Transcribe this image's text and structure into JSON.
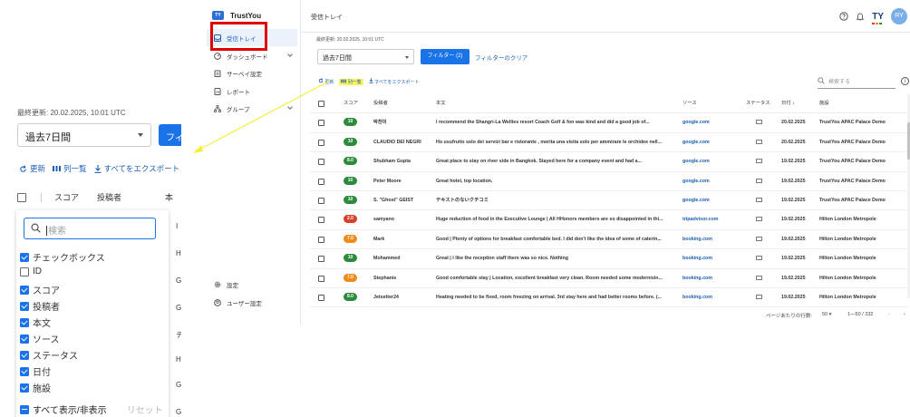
{
  "zoom": {
    "last_updated": "最終更新: 20.02.2025, 10:01 UTC",
    "period": "過去7日間",
    "filter_label": "フィ",
    "actions": {
      "refresh": "更新",
      "list": "列一覧",
      "export": "すべてをエクスポート"
    },
    "header": {
      "score": "スコア",
      "author": "投稿者",
      "cut": "本"
    },
    "search_placeholder": "検索",
    "columns": [
      {
        "label": "チェックボックス",
        "checked": true
      },
      {
        "label": "ID",
        "checked": false
      },
      {
        "label": "スコア",
        "checked": true
      },
      {
        "label": "投稿者",
        "checked": true
      },
      {
        "label": "本文",
        "checked": true
      },
      {
        "label": "ソース",
        "checked": true
      },
      {
        "label": "ステータス",
        "checked": true
      },
      {
        "label": "日付",
        "checked": true
      },
      {
        "label": "施設",
        "checked": true
      }
    ],
    "toggle_all": "すべて表示/非表示",
    "reset": "リセット",
    "side_letters": [
      "I",
      "H",
      "G",
      "G",
      "テ",
      "H",
      "G",
      "G"
    ]
  },
  "sidebar": {
    "brand": "TrustYou",
    "brand_logo": "TY",
    "items": [
      {
        "label": "受信トレイ",
        "icon": "inbox-icon"
      },
      {
        "label": "ダッシュボード",
        "icon": "dashboard-icon"
      },
      {
        "label": "サーベイ設定",
        "icon": "clipboard-icon"
      },
      {
        "label": "レポート",
        "icon": "report-icon"
      },
      {
        "label": "グループ",
        "icon": "hierarchy-icon"
      }
    ],
    "bottom": [
      {
        "label": "設定",
        "icon": "gear-icon"
      },
      {
        "label": "ユーザー設定",
        "icon": "user-icon"
      }
    ]
  },
  "header": {
    "title": "受信トレイ",
    "logo_text": "TY",
    "avatar": "RY"
  },
  "main": {
    "last_updated": "最終更新: 20.02.2025, 10:01 UTC",
    "period": "過去7日間",
    "filter_button": "フィルター (2)",
    "clear_filter": "フィルターのクリア",
    "actions": {
      "refresh": "更新",
      "list": "列一覧",
      "export": "すべてをエクスポート"
    },
    "search_placeholder": "検索する",
    "columns": {
      "score": "スコア",
      "author": "投稿者",
      "body": "本文",
      "source": "ソース",
      "status": "ステータス",
      "date": "日付",
      "property": "施設"
    },
    "rows": [
      {
        "score": "10",
        "color": "#2e8b3e",
        "author": "박찬미",
        "body": "I recommend the Shangri-La Wellies resort Coach Golf & fon was kind and did a good job of...",
        "source": "google.com",
        "date": "20.02.2025",
        "property": "TrustYou APAC Palace Demo"
      },
      {
        "score": "10",
        "color": "#2e8b3e",
        "author": "CLAUDIO DEI NEGRI",
        "body": "Ho usufruito solo dei servizi bar e ristorante , merita una visita solo per ammirare le orchidee nell...",
        "source": "google.com",
        "date": "20.02.2025",
        "property": "TrustYou APAC Palace Demo"
      },
      {
        "score": "8.0",
        "color": "#2e8b3e",
        "author": "Shubham Gupta",
        "body": "Great place to stay on river side in Bangkok. Stayed here for a company event and had a...",
        "source": "google.com",
        "date": "19.02.2025",
        "property": "TrustYou APAC Palace Demo"
      },
      {
        "score": "10",
        "color": "#2e8b3e",
        "author": "Peter Moore",
        "body": "Great hotel, top location.",
        "source": "google.com",
        "date": "19.02.2025",
        "property": "TrustYou APAC Palace Demo"
      },
      {
        "score": "10",
        "color": "#2e8b3e",
        "author": "S. \"Ghost\" GEIST",
        "body": "テキストのないクチコミ",
        "source": "google.com",
        "date": "19.02.2025",
        "property": "TrustYou APAC Palace Demo"
      },
      {
        "score": "2.0",
        "color": "#d9402b",
        "author": "samyano",
        "body": "Huge reduction of food in the Executive Lounge | All HHonors members are so disappointed in thi...",
        "source": "tripadvisor.com",
        "date": "19.02.2025",
        "property": "Hilton London Metropole"
      },
      {
        "score": "7.0",
        "color": "#f08a1c",
        "author": "Mark",
        "body": "Good | Plenty of options for breakfast comfortable bed. I did don't like the idea of some of caterin...",
        "source": "booking.com",
        "date": "19.02.2025",
        "property": "Hilton London Metropole"
      },
      {
        "score": "10",
        "color": "#2e8b3e",
        "author": "Mohammed",
        "body": "Great | I like the reception staff there was so nice. Nothing",
        "source": "booking.com",
        "date": "19.02.2025",
        "property": "Hilton London Metropole"
      },
      {
        "score": "7.0",
        "color": "#f08a1c",
        "author": "Stephanie",
        "body": "Good comfortable stay | Location, excellent breakfast very clean. Room needed some modernisin...",
        "source": "booking.com",
        "date": "19.02.2025",
        "property": "Hilton London Metropole"
      },
      {
        "score": "8.0",
        "color": "#2e8b3e",
        "author": "Jetsetter24",
        "body": "Heating needed to be fixed, room freezing on arrival. 3rd stay here and had better rooms before. (...",
        "source": "booking.com",
        "date": "19.02.2025",
        "property": "Hilton London Metropole"
      }
    ],
    "pager": {
      "label": "ページあたりの行数:",
      "rows_per_page": "50 ▾",
      "range": "1—50 / 332",
      "prev": "‹",
      "next": "›"
    }
  },
  "colors": {
    "accent": "#1a73e8",
    "highlight_box": "#e00000",
    "highlighter": "#fbf35a",
    "arrow": "#f5ef3a"
  }
}
